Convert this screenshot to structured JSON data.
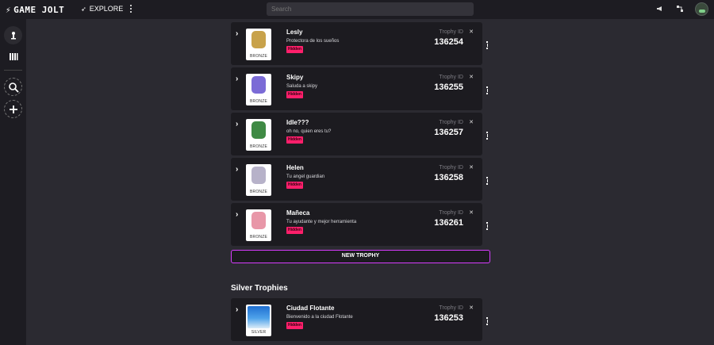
{
  "app": {
    "logo_text": "GAME JOLT",
    "explore_label": "EXPLORE",
    "search_placeholder": "Search"
  },
  "topbar_icons": [
    "megaphone-icon",
    "activity-icon",
    "user-avatar"
  ],
  "sidebar": {
    "items": [
      {
        "name": "library-icon"
      },
      {
        "name": "stats-icon"
      },
      {
        "name": "discover-icon"
      },
      {
        "name": "add-icon"
      }
    ]
  },
  "bronze_trophies": [
    {
      "name": "Lesly",
      "description": "Protectora de los sueños",
      "hidden_label": "Hidden",
      "tier": "BRONZE",
      "id_label": "Trophy ID",
      "id": "136254",
      "sprite_color": "#c8a24a"
    },
    {
      "name": "Skipy",
      "description": "Saluda a skipy",
      "hidden_label": "Hidden",
      "tier": "BRONZE",
      "id_label": "Trophy ID",
      "id": "136255",
      "sprite_color": "#7b6bd6"
    },
    {
      "name": "Idle???",
      "description": "oh no, quien eres tu?",
      "hidden_label": "Hidden",
      "tier": "BRONZE",
      "id_label": "Trophy ID",
      "id": "136257",
      "sprite_color": "#3f8a44"
    },
    {
      "name": "Helen",
      "description": "Tu angel guardian",
      "hidden_label": "Hidden",
      "tier": "BRONZE",
      "id_label": "Trophy ID",
      "id": "136258",
      "sprite_color": "#b7b2c9"
    },
    {
      "name": "Mañeca",
      "description": "Tu ayudante y mejor herramienta",
      "hidden_label": "Hidden",
      "tier": "BRONZE",
      "id_label": "Trophy ID",
      "id": "136261",
      "sprite_color": "#e897a8"
    }
  ],
  "new_trophy_label": "NEW TROPHY",
  "silver_section_title": "Silver Trophies",
  "silver_trophies": [
    {
      "name": "Ciudad Flotante",
      "description": "Bienvenido a la ciudad Flotante",
      "hidden_label": "Hidden",
      "tier": "SILVER",
      "id_label": "Trophy ID",
      "id": "136253"
    }
  ],
  "colors": {
    "accent": "#d83cff",
    "hidden_badge": "#ff1f6b",
    "background": "#2b2a31",
    "card": "#1c1b20"
  }
}
